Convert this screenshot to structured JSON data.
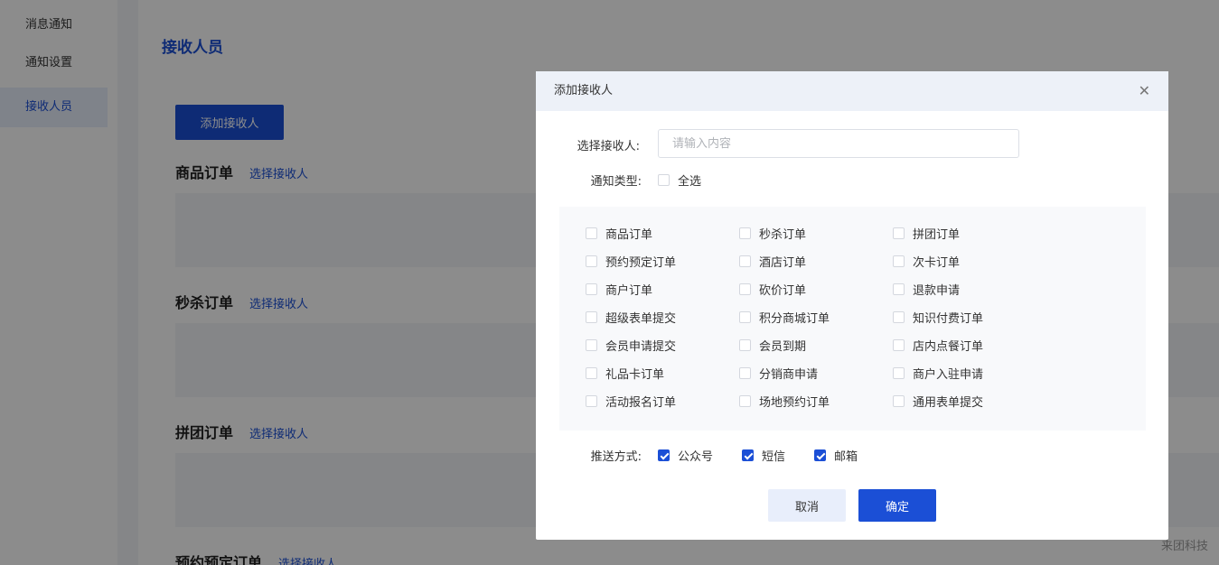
{
  "sidebar": {
    "items": [
      {
        "label": "消息通知"
      },
      {
        "label": "通知设置"
      },
      {
        "label": "接收人员"
      }
    ]
  },
  "main": {
    "title": "接收人员",
    "add_button": "添加接收人",
    "sections": [
      {
        "title": "商品订单",
        "link": "选择接收人"
      },
      {
        "title": "秒杀订单",
        "link": "选择接收人"
      },
      {
        "title": "拼团订单",
        "link": "选择接收人"
      },
      {
        "title": "预约预定订单",
        "link": "选择接收人"
      }
    ]
  },
  "modal": {
    "title": "添加接收人",
    "close_icon": "close-icon",
    "recipient_label": "选择接收人:",
    "recipient_placeholder": "请输入内容",
    "type_label": "通知类型:",
    "select_all": "全选",
    "types": [
      "商品订单",
      "秒杀订单",
      "拼团订单",
      "预约预定订单",
      "酒店订单",
      "次卡订单",
      "商户订单",
      "砍价订单",
      "退款申请",
      "超级表单提交",
      "积分商城订单",
      "知识付费订单",
      "会员申请提交",
      "会员到期",
      "店内点餐订单",
      "礼品卡订单",
      "分销商申请",
      "商户入驻申请",
      "活动报名订单",
      "场地预约订单",
      "通用表单提交"
    ],
    "push_label": "推送方式:",
    "push_methods": [
      {
        "label": "公众号",
        "checked": true
      },
      {
        "label": "短信",
        "checked": true
      },
      {
        "label": "邮箱",
        "checked": true
      }
    ],
    "cancel_button": "取消",
    "confirm_button": "确定"
  },
  "watermark": "来团科技",
  "colors": {
    "accent": "#1b4fd6",
    "overlay": "rgba(0,0,0,0.45)"
  }
}
